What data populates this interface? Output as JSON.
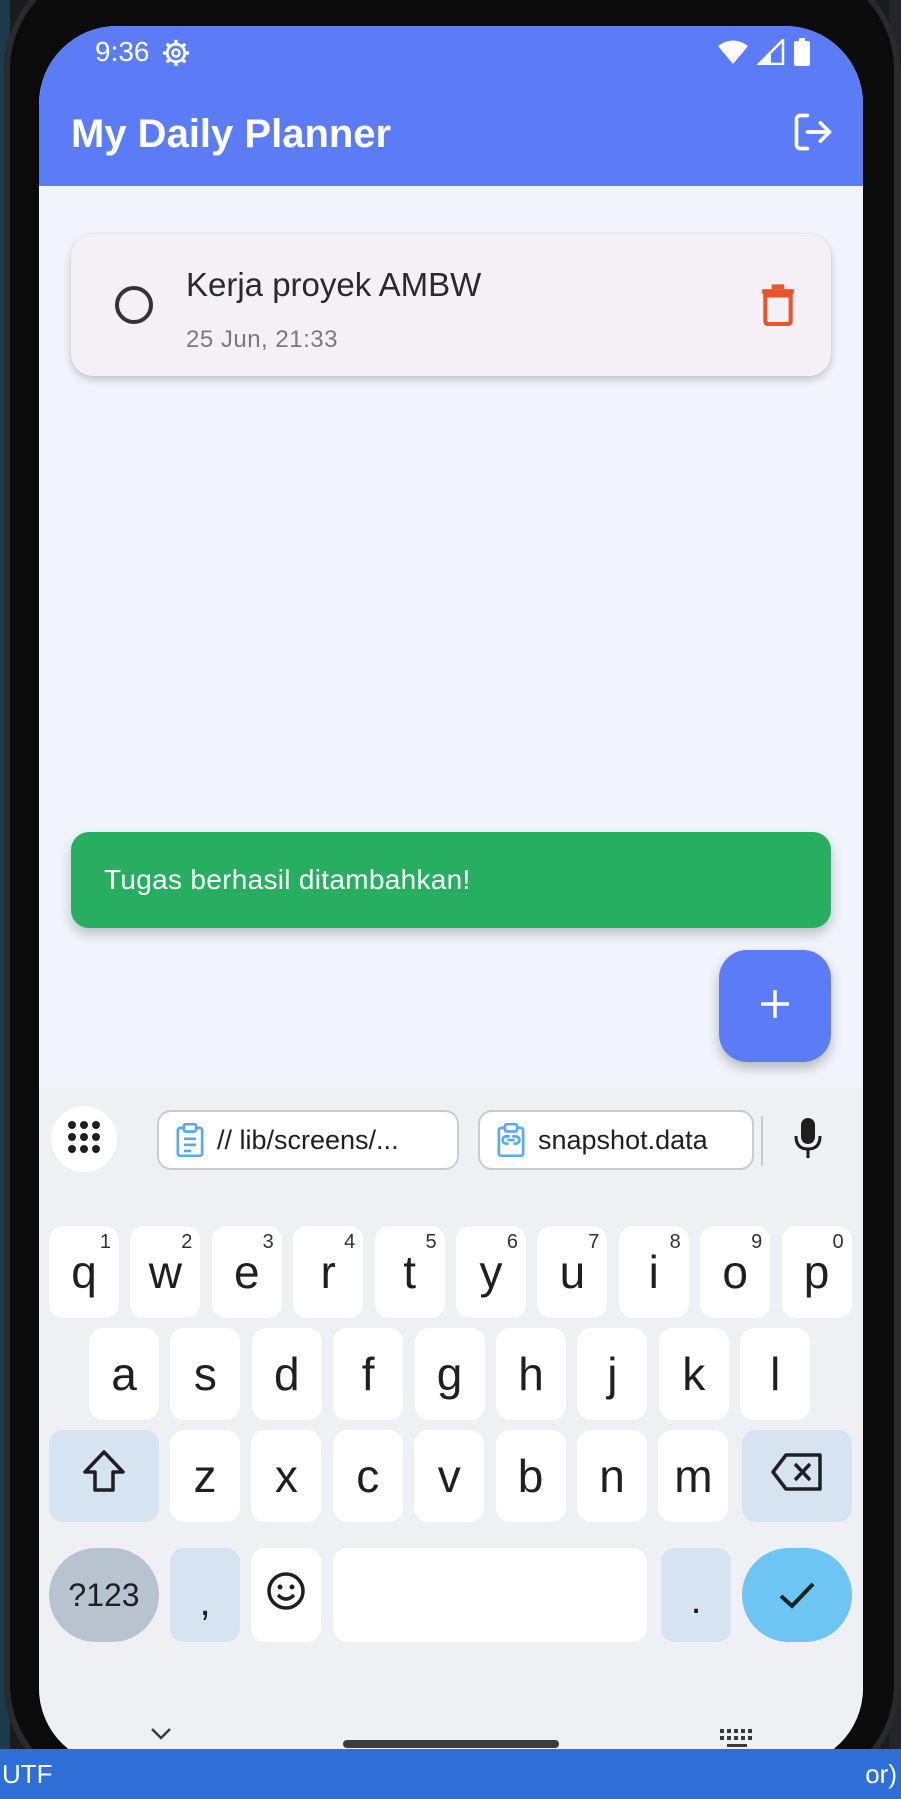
{
  "status_bar": {
    "time": "9:36"
  },
  "app_bar": {
    "title": "My Daily Planner"
  },
  "tasks": [
    {
      "title": "Kerja proyek AMBW",
      "date": "25 Jun, 21:33"
    }
  ],
  "snackbar": {
    "message": "Tugas berhasil ditambahkan!"
  },
  "keyboard": {
    "suggestions": [
      "// lib/screens/...",
      "snapshot.data"
    ],
    "row1": [
      {
        "key": "q",
        "hint": "1"
      },
      {
        "key": "w",
        "hint": "2"
      },
      {
        "key": "e",
        "hint": "3"
      },
      {
        "key": "r",
        "hint": "4"
      },
      {
        "key": "t",
        "hint": "5"
      },
      {
        "key": "y",
        "hint": "6"
      },
      {
        "key": "u",
        "hint": "7"
      },
      {
        "key": "i",
        "hint": "8"
      },
      {
        "key": "o",
        "hint": "9"
      },
      {
        "key": "p",
        "hint": "0"
      }
    ],
    "row2": [
      "a",
      "s",
      "d",
      "f",
      "g",
      "h",
      "j",
      "k",
      "l"
    ],
    "row3": [
      "z",
      "x",
      "c",
      "v",
      "b",
      "n",
      "m"
    ],
    "symbols_label": "?123",
    "comma": ",",
    "period": "."
  },
  "desktop": {
    "left_edge_text": "UTF",
    "right_edge_text": "or)"
  },
  "colors": {
    "app_bar": "#5b7cf6",
    "snackbar": "#27ae60",
    "delete": "#e8542b",
    "fab": "#5b7cf6",
    "enter_key": "#6cc5f2"
  }
}
